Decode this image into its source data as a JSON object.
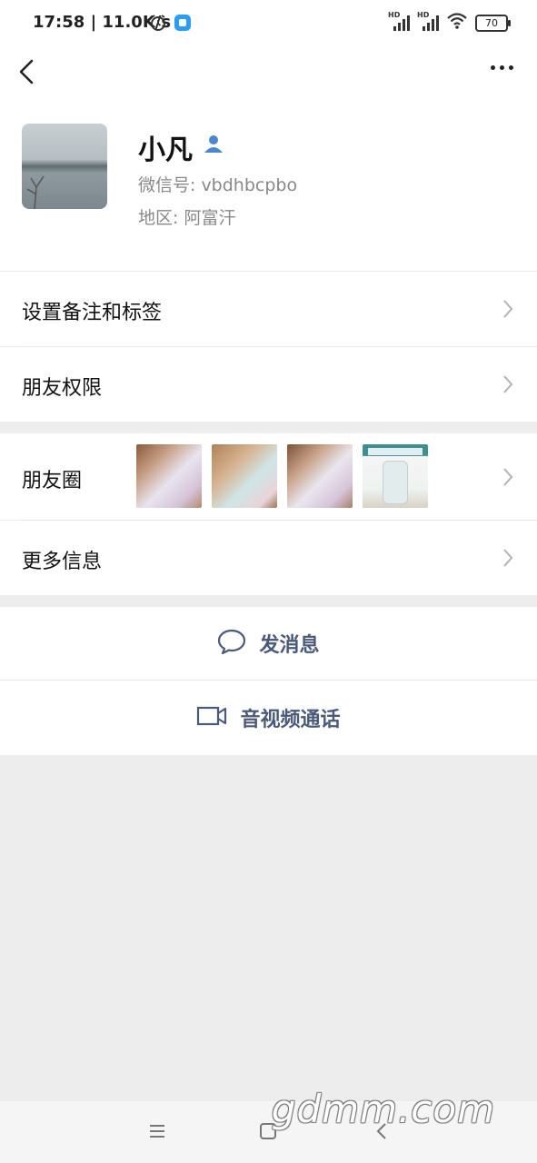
{
  "status_bar": {
    "time": "17:58 | 11.0K/s",
    "net_a": "HD",
    "net_b": "HD",
    "battery": "70"
  },
  "profile": {
    "name": "小凡",
    "wechat_id": "微信号:  vbdhbcpbo",
    "region": "地区:  阿富汗"
  },
  "menu": {
    "remark_tags": "设置备注和标签",
    "friend_permissions": "朋友权限",
    "moments": "朋友圈",
    "more_info": "更多信息"
  },
  "actions": {
    "message": "发消息",
    "av_call": "音视频通话"
  },
  "watermark": "gdmm.com",
  "colors": {
    "accent_text": "#4a5a7a",
    "verified_icon": "#4b86d1",
    "background": "#ededed"
  }
}
